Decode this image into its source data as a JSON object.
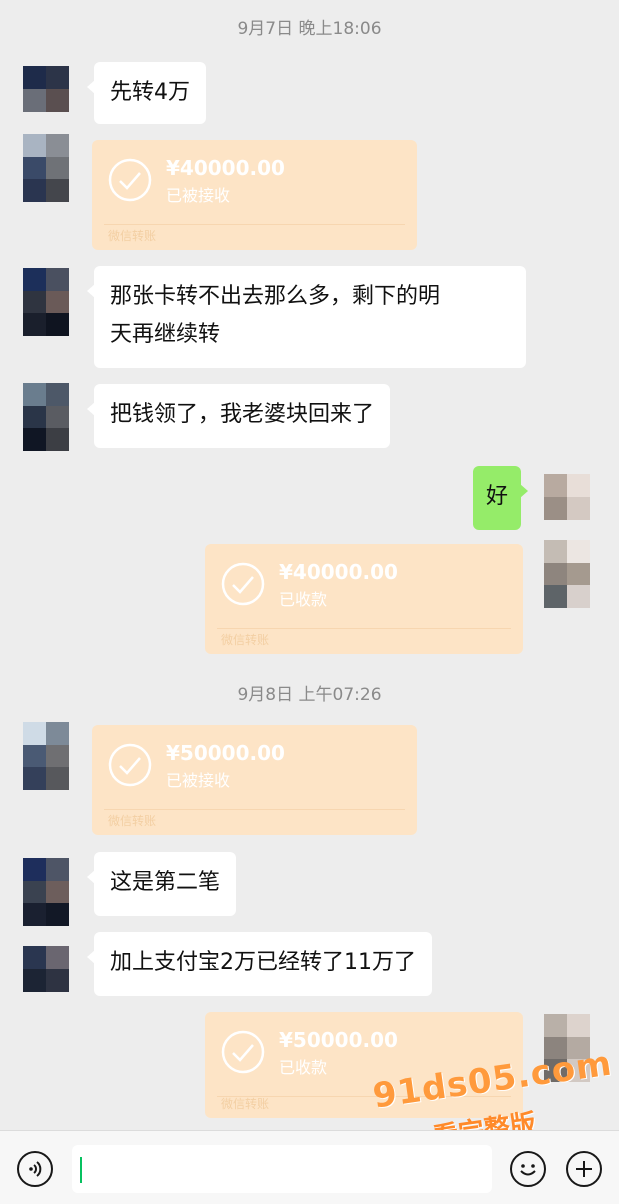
{
  "timestamps": [
    "9月7日 晚上18:06",
    "9月8日 上午07:26"
  ],
  "messages": {
    "m1": "先转4万",
    "m2_line1": "那张卡转不出去那么多，剩下的明",
    "m2_line2": "天再继续转",
    "m3": "把钱领了，我老婆块回来了",
    "m4": "好",
    "m5": "这是第二笔",
    "m6": "加上支付宝2万已经转了11万了"
  },
  "transfers": [
    {
      "amount": "¥40000.00",
      "status": "已被接收",
      "brand": "微信转账"
    },
    {
      "amount": "¥40000.00",
      "status": "已收款",
      "brand": "微信转账"
    },
    {
      "amount": "¥50000.00",
      "status": "已被接收",
      "brand": "微信转账"
    },
    {
      "amount": "¥50000.00",
      "status": "已收款",
      "brand": "微信转账"
    }
  ],
  "input": {
    "value": ""
  },
  "icons": {
    "voice": "voice-icon",
    "emoji": "emoji-icon",
    "plus": "plus-icon",
    "check": "check-circle-icon"
  },
  "watermark": {
    "line1": "91ds05.com",
    "line2": "看完整版"
  },
  "colors": {
    "background": "#ededed",
    "mine_bubble": "#95ec69",
    "transfer_card": "#fde4c6",
    "cursor": "#07c160"
  }
}
